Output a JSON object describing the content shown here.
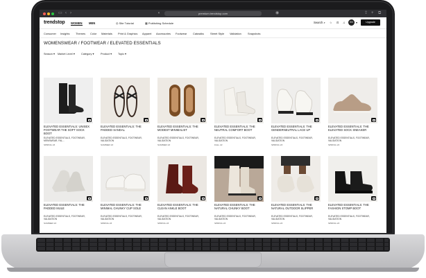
{
  "browser": {
    "url": "premium.trendstop.com"
  },
  "header": {
    "logo": "trendstop",
    "genders": [
      "WOMEN",
      "MEN"
    ],
    "links": [
      "Site Tutorial",
      "Publishing Schedule"
    ],
    "search_label": "Search",
    "avatar_initials": "KN",
    "upgrade_label": "Upgrade"
  },
  "nav": [
    "Consumer",
    "Insights",
    "Themes",
    "Color",
    "Materials",
    "Print & Graphics",
    "Apparel",
    "Accessories",
    "Footwear",
    "Catwalks",
    "Street Style",
    "Validation",
    "Snapshots"
  ],
  "breadcrumb": "WOMENSWEAR  /  FOOTWEAR  /  ELEVATED ESSENTIALS",
  "filters": [
    "Season",
    "Market Level",
    "Category",
    "Product",
    "Topic"
  ],
  "products": [
    {
      "title": "ELEVATED ESSENTIALS: UNISEX FOOTWEAR THE SOFT SOCK BOOT",
      "meta": "ELEVATED ESSENTIALS, FOOTWEAR, MENSWEAR, FAL...",
      "season": "SPRING 23"
    },
    {
      "title": "ELEVATED ESSENTIALS: THE PADDED SANDAL",
      "meta": "ELEVATED ESSENTIALS, FOOTWEAR, VALIDATION",
      "season": "SUMMER 23"
    },
    {
      "title": "ELEVATED ESSENTIALS: THE MODEST MINIMALIST",
      "meta": "ELEVATED ESSENTIALS, FOOTWEAR, VALIDATION",
      "season": "SUMMER 23"
    },
    {
      "title": "ELEVATED ESSENTIALS: THE NEUTRAL COMFORT BOOT",
      "meta": "ELEVATED ESSENTIALS, FOOTWEAR, VALIDATION",
      "season": "FALL 22"
    },
    {
      "title": "ELEVATED ESSENTIALS: THE GENDERNEUTRAL LACE UP",
      "meta": "ELEVATED ESSENTIALS, FOOTWEAR, VALIDATION",
      "season": "SPRING 23"
    },
    {
      "title": "ELEVATED ESSENTIALS: THE ELEVATED SOCK SNEAKER",
      "meta": "ELEVATED ESSENTIALS, FOOTWEAR, VALIDATION",
      "season": "SPRING 23"
    },
    {
      "title": "ELEVATED ESSENTIALS: THE PADDED MULE",
      "meta": "ELEVATED ESSENTIALS, FOOTWEAR, VALIDATION",
      "season": "SUMMER 23"
    },
    {
      "title": "ELEVATED ESSENTIALS: THE MINIMAL CHUNKY CUP SOLE",
      "meta": "ELEVATED ESSENTIALS, FOOTWEAR, VALIDATION",
      "season": "SPRING 23"
    },
    {
      "title": "ELEVATED ESSENTIALS: THE CLEAN ANKLE BOOT",
      "meta": "ELEVATED ESSENTIALS, FOOTWEAR, VALIDATION",
      "season": "SPRING 23"
    },
    {
      "title": "ELEVATED ESSENTIALS: THE NATURAL CHUNKY BOOT",
      "meta": "ELEVATED ESSENTIALS, FOOTWEAR, VALIDATION",
      "season": "SPRING 23"
    },
    {
      "title": "ELEVATED ESSENTIALS: THE NATURAL OUTDOOR SLIPPER",
      "meta": "ELEVATED ESSENTIALS, FOOTWEAR, VALIDATION",
      "season": "SPRING 23"
    },
    {
      "title": "ELEVATED ESSENTIALS: THE FASHION STOMP BOOT",
      "meta": "ELEVATED ESSENTIALS, FOOTWEAR, VALIDATION",
      "season": "SPRING 23"
    }
  ],
  "colors": {
    "accent": "#111111",
    "chrome": "#2f2f33"
  }
}
